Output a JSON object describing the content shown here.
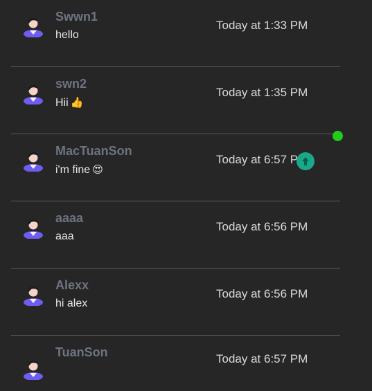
{
  "colors": {
    "background": "#262626",
    "name": "#6d7480",
    "message": "#e8e8e8",
    "time": "#dadada",
    "divider": "#5a5a5a",
    "upload_button": "#1aa88a",
    "online_dot": "#22cc1a"
  },
  "messages": [
    {
      "name": "Swwn1",
      "text": "hello",
      "emoji": "",
      "time": "Today at 1:33 PM"
    },
    {
      "name": "swn2",
      "text": "Hii",
      "emoji": "👍",
      "time": "Today at 1:35 PM"
    },
    {
      "name": "MacTuanSon",
      "text": "i'm fine",
      "emoji": "😍",
      "time": "Today at 6:57 PM"
    },
    {
      "name": "aaaa",
      "text": "aaa",
      "emoji": "",
      "time": "Today at 6:56 PM"
    },
    {
      "name": "Alexx",
      "text": "hi alex",
      "emoji": "",
      "time": "Today at 6:56 PM"
    },
    {
      "name": "TuanSon",
      "text": "",
      "emoji": "",
      "time": "Today at 6:57 PM"
    }
  ],
  "icons": {
    "avatar": "user-avatar-icon",
    "upload": "arrow-up-icon",
    "status": "online-status-dot"
  }
}
